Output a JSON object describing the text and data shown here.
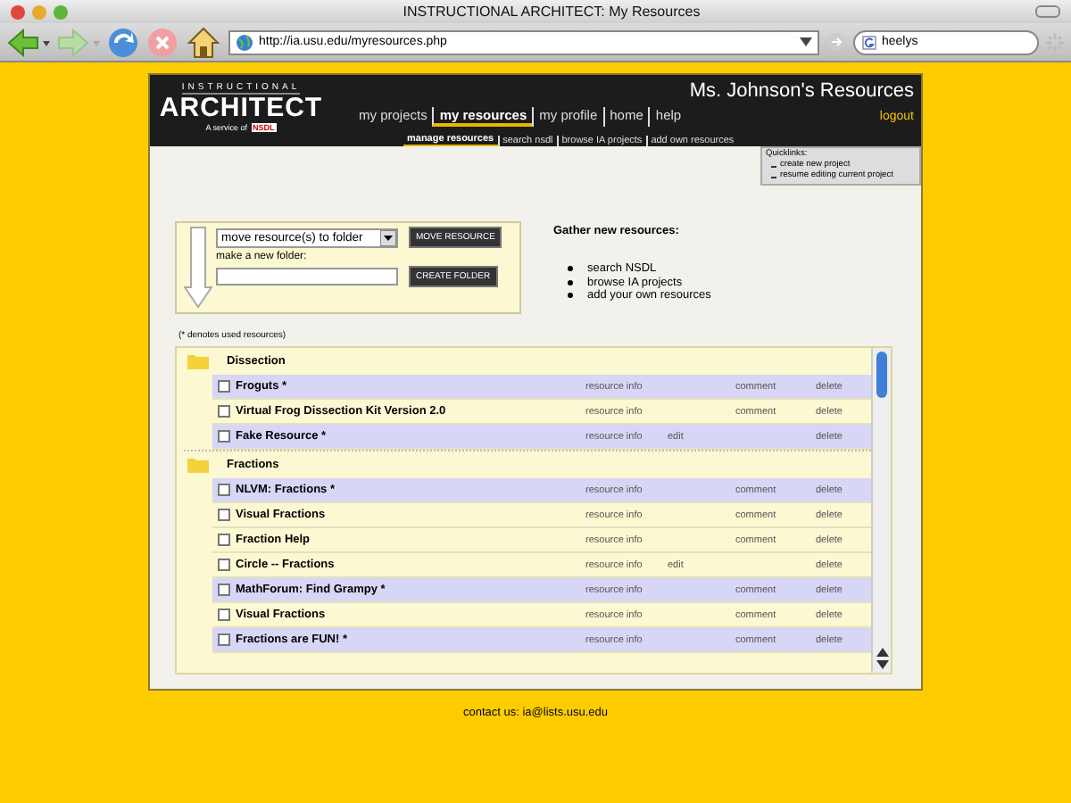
{
  "browser": {
    "title": "INSTRUCTIONAL ARCHITECT: My Resources",
    "url": "http://ia.usu.edu/myresources.php",
    "search": "heelys"
  },
  "header": {
    "logo_top": "INSTRUCTIONAL",
    "logo": "ARCHITECT",
    "logo_sub": "A service of",
    "logo_badge": "NSDL",
    "title": "Ms. Johnson's Resources",
    "logout": "logout",
    "nav": [
      {
        "label": "my projects",
        "selected": false
      },
      {
        "label": "my resources",
        "selected": true
      },
      {
        "label": "my profile",
        "selected": false
      },
      {
        "label": "home",
        "selected": false
      },
      {
        "label": "help",
        "selected": false
      }
    ],
    "subnav": [
      {
        "label": "manage resources",
        "selected": true
      },
      {
        "label": "search nsdl",
        "selected": false
      },
      {
        "label": "browse IA projects",
        "selected": false
      },
      {
        "label": "add own resources",
        "selected": false
      }
    ]
  },
  "quicklinks": {
    "title": "Quicklinks:",
    "items": [
      "create new project",
      "resume editing current project"
    ]
  },
  "folder_tools": {
    "select": "move resource(s) to folder",
    "move_button": "MOVE RESOURCE",
    "new_folder_label": "make a new folder:",
    "create_button": "CREATE FOLDER"
  },
  "gather": {
    "title": "Gather new resources:",
    "items": [
      "search NSDL",
      "browse IA projects",
      "add your own resources"
    ]
  },
  "note": "(* denotes used resources)",
  "folders": [
    {
      "name": "Dissection",
      "resources": [
        {
          "title": "Froguts *",
          "used": true,
          "checked": false,
          "kind": "nsdl",
          "info": "resource info",
          "action": "comment",
          "delete": "delete"
        },
        {
          "title": "Virtual Frog Dissection Kit Version 2.0",
          "used": false,
          "checked": false,
          "kind": "nsdl",
          "info": "resource info",
          "action": "comment",
          "delete": "delete"
        },
        {
          "title": "Fake Resource *",
          "used": true,
          "checked": false,
          "kind": "own",
          "info": "resource info",
          "action": "edit",
          "delete": "delete"
        }
      ]
    },
    {
      "name": "Fractions",
      "resources": [
        {
          "title": "NLVM: Fractions *",
          "used": true,
          "checked": false,
          "kind": "nsdl",
          "info": "resource info",
          "action": "comment",
          "delete": "delete"
        },
        {
          "title": "Visual Fractions",
          "used": false,
          "checked": false,
          "kind": "nsdl",
          "info": "resource info",
          "action": "comment",
          "delete": "delete"
        },
        {
          "title": "Fraction Help",
          "used": false,
          "checked": false,
          "kind": "nsdl",
          "info": "resource info",
          "action": "comment",
          "delete": "delete"
        },
        {
          "title": "Circle -- Fractions",
          "used": false,
          "checked": false,
          "kind": "own",
          "info": "resource info",
          "action": "edit",
          "delete": "delete"
        },
        {
          "title": "MathForum: Find Grampy *",
          "used": true,
          "checked": false,
          "kind": "nsdl",
          "info": "resource info",
          "action": "comment",
          "delete": "delete"
        },
        {
          "title": "Visual Fractions",
          "used": false,
          "checked": false,
          "kind": "nsdl",
          "info": "resource info",
          "action": "comment",
          "delete": "delete"
        },
        {
          "title": "Fractions are FUN! *",
          "used": true,
          "checked": false,
          "kind": "nsdl",
          "info": "resource info",
          "action": "comment",
          "delete": "delete"
        }
      ]
    }
  ],
  "footer": "contact us: ia@lists.usu.edu"
}
